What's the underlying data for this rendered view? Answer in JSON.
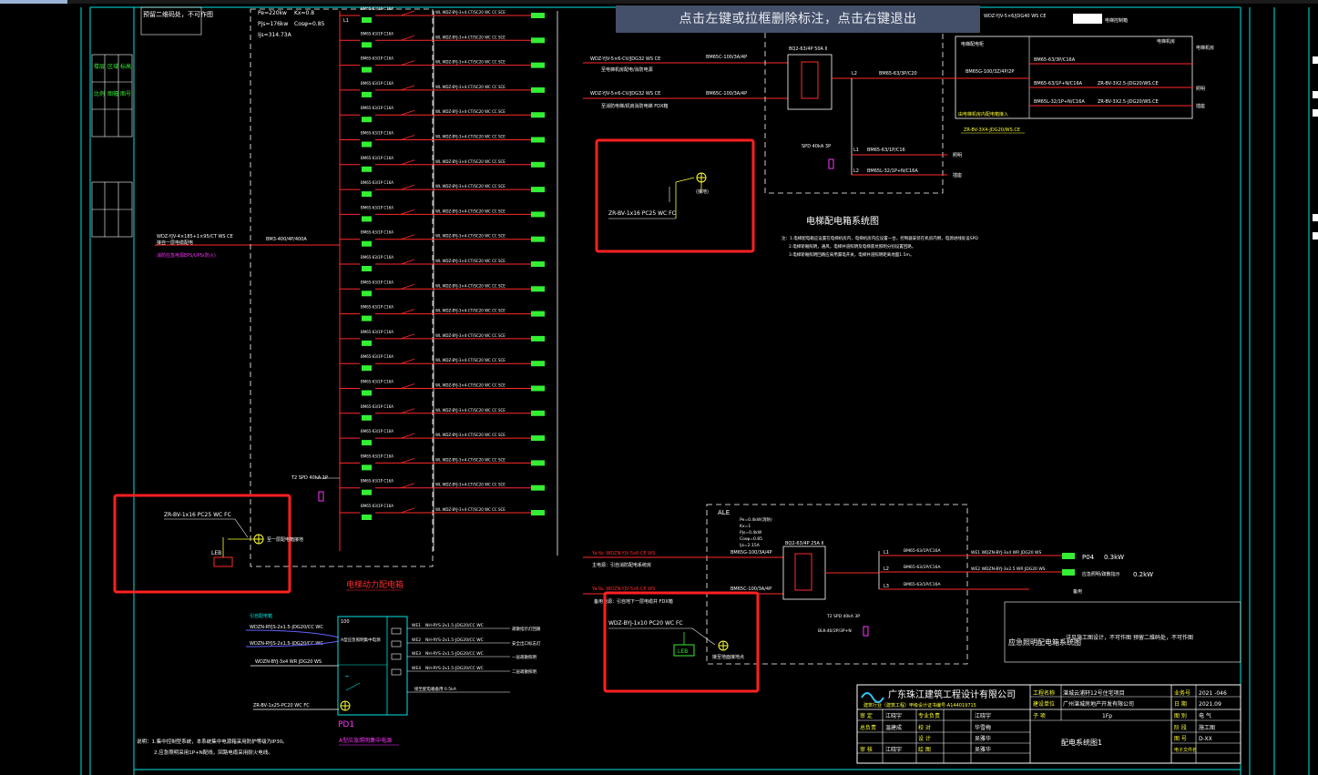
{
  "hint": {
    "text": "点击左键或拉框删除标注，点击右键退出"
  },
  "top_left": {
    "note": "预留二维码处，不可作图",
    "load_params": [
      "Pe=220kw",
      "Kx=0.8",
      "Pjs=176kw",
      "Cosφ=0.85",
      "Ijs=314.73A"
    ],
    "incoming": [
      "WDZ-YJV-4×185+1×95/CT WS CE"
    ],
    "incoming_note": "接自一层电缆配电",
    "incoming_note2": "消防应急电源EPS/UPS(防火)",
    "main_breaker": "BM3-400/4P/400A",
    "leb_cable": "ZR-BV-1x16 PC25 WC FC",
    "leb_label": "LEB",
    "leb_note": "至一层配电箱接地",
    "spd": "T2 SPD 40kA 1P",
    "bottom_title": "电梯动力配电箱"
  },
  "rows": {
    "breaker": "BM65-63/1P C16A",
    "feeder": "WL  WDZ-BYJ-3×4-CT/SC20 WC CC SCE",
    "phases": [
      "L1",
      "L2",
      "L3"
    ],
    "breaker_count": 21
  },
  "elevator": {
    "incoming1": "WDZ-YJV-5×6-CV/JDG32 WS CE",
    "incoming1_note": "至电梯机房配电/消防电源",
    "incoming2": "WDZ-YJV-5×6-CV/JDG32 WS CE",
    "incoming2_note": "至消防电梯/机房消防电梯 FDX箱",
    "breaker1": "BM65C-100/3A/4P",
    "breaker2": "BM65C-100/3A/4P",
    "ats": "BQ2-63/4P 50A Ⅱ",
    "out_main": "BM65-63/3P/C20",
    "out_l1": "BM65-63/1P/C16",
    "out_l2": "BM65L-32/1P+N/C16A",
    "spd": "SPD 40kA 3P",
    "leb_cable": "ZR-BV-1x16 PC25 WC FC",
    "leb_note": "(接地)",
    "title": "电梯配电箱系统图",
    "notes": [
      "注：1.电梯配电箱应设置在电梯机房内，电梯机房内应设置一台，控制器安装在机房内侧，电源进线处设SPD",
      "2.电梯轿厢照明，通风，电梯井道照明及电梯底坑照明分别设置回路。",
      "3.电梯轿厢照明回路应采用漏电开关，电梯井道照明距离地面1.5m。"
    ],
    "right_box": {
      "top_cable": "WDZ-YJV-5×6/JDG40 WS CE",
      "legend_a": "电梯控制箱",
      "legend_b": "电梯机房",
      "col_a": "BM65-63/3P/C16A",
      "col_b": "BM65-63/1P+N/C16A",
      "col_c": "BM65L-32/1P+N/C16A",
      "cab_a": "ZR-BV-3X2.5-JDG20/WS.CE",
      "cab_b": "ZR-BV-3X2.5-JDG20/WS.CE",
      "side": [
        "电梯机房",
        "照明",
        "插座"
      ],
      "box_label": "电梯配电柜",
      "b2": "BM65G-100/3Z/4P/2P",
      "bottom_cable": "ZR-BV-3X4-JDG20/WS.CE",
      "bottom_note": "由电梯机房内配电箱接入"
    }
  },
  "ale": {
    "label": "ALE",
    "params": [
      "Pe=0.4kW(消防)",
      "Kx=1",
      "Pjs=0.4kW",
      "Cosφ=0.85",
      "Ijs=2.15A"
    ],
    "incoming1": "Ya-Ya: WDZN-YJV-5x6 CE WS",
    "incoming1_note": "主电源：引自消防配电系统房",
    "incoming2": "Ya-Ya: WDZN-YJV-5x6 CE WS",
    "incoming2_note": "备用电源：引自地下一层电缆井 FDX箱",
    "breaker1": "BM65G-100/3A/4P",
    "breaker2": "BM65C-100/3A/4P",
    "ats": "BQ2-63/4P 25A Ⅱ",
    "spd": "T2 SPD 40kA 3P",
    "spd_b": "BLK-40/2P/3P+N",
    "phases": [
      "L1",
      "L2",
      "L3"
    ],
    "out1_breaker": "BM65-63/1P/C16A",
    "out1_cable": "WE1 WDZN-BYJ-3x4 WR JDG20 WS",
    "out1_label": "P04",
    "out1_kw": "0.3kW",
    "out2_breaker": "BM65-63/1P/C16A",
    "out2_cable": "WE2 WDZN-BYJ-3x2.5 WR JDG20 WS",
    "out2_label": "应急照明/疏散指示",
    "out2_kw": "0.2kW",
    "out3_breaker": "BM65-63/1P/C16A",
    "out3_label": "备用",
    "leb_cable": "WDZ-BYJ-1x10  PC20  WC FC",
    "leb_label": "LEB",
    "leb_note": "接至地面接地点",
    "side_note": "应急照明配电箱系统图",
    "side_note2": "详见施工图设计，不可作图",
    "side_note3": "预留二维码处，不可作图"
  },
  "pd1": {
    "title": "A型应急照明集中电源",
    "label": "PD1",
    "incoming": [
      "WDZN-RYJS-2x1.5-JDG20/CC WC",
      "WDZN-RYJS-2x1.5-JDG20/CC WC",
      "WDZN-BYJ-3x4 WR JDG20 WS"
    ],
    "incoming_note": "引自配电箱",
    "leb_cable": "ZR-BV-1x25-PC20 WC FC",
    "panel": "A型应急照明集中电源",
    "outs": [
      {
        "id": "WE1",
        "cable": "NH-RYS-2x1.5-JDG20/CC WC",
        "label": "疏散指示灯回路"
      },
      {
        "id": "WE2",
        "cable": "NH-RYS-2x1.5-JDG20/CC WC",
        "label": "安全出口标志灯"
      },
      {
        "id": "WE3",
        "cable": "NH-RYS-2x1.5-JDG20/CC WC",
        "label": "一层疏散照明"
      },
      {
        "id": "WE4",
        "cable": "NH-RYS-2x1.5-JDG20/CC WC",
        "label": "二层疏散照明"
      }
    ],
    "spare": "接至配电箱备用 0.5kA",
    "notes": [
      "说明：1.集中控制型系统，本系统集中电源箱采用防护等级为IP30。",
      "2.应急照明采用1P+N配线，回路电缆采用耐火电线。"
    ]
  },
  "title_block": {
    "company": "广东珠江建筑工程设计有限公司",
    "company_sub": "建筑行业（建筑工程）甲级设计证书编号-A144019715",
    "project_label": "工程名称",
    "project_value": "湛城云浦轩12号住宅项目",
    "client_label": "建设单位",
    "client_value": "广州湛城房地产开发有限公司",
    "sub_label": "子 项",
    "sub_value": "1Fp",
    "code_label": "业务号",
    "code_value": "2021 -046",
    "date_label": "日 期",
    "date_value": "2021.09",
    "cat_label": "图 别",
    "cat_value": "电 气",
    "stage_label": "阶 段",
    "stage_value": "施工图",
    "no_label": "图 号",
    "no_value": "D-XX",
    "seal_label": "电子文件名",
    "drawing_title": "配电系统图1",
    "roles": [
      {
        "a": "审 定",
        "b": "江晓宇",
        "c": "专业负责",
        "d": "江晓宇"
      },
      {
        "a": "总负责",
        "b": "温建成",
        "c": "校 对",
        "d": "华雪梅"
      },
      {
        "a": "",
        "b": "",
        "c": "设 计",
        "d": "吴雅华"
      },
      {
        "a": "审 核",
        "b": "江晓宇",
        "c": "绘 图",
        "d": "吴雅华"
      }
    ]
  },
  "left_ruler": {
    "labels": [
      "楼层",
      "区域",
      "标高",
      "比例",
      "图幅",
      "图号"
    ]
  },
  "colors": {
    "line_red": "#ff2a2a",
    "line_white": "#ffffff",
    "line_yellow": "#ffff33",
    "line_cyan": "#00e5e5",
    "line_green": "#33ee33",
    "magenta": "#ff33ff",
    "highlight": "#ff2020",
    "hint_bg": "#44506a"
  }
}
